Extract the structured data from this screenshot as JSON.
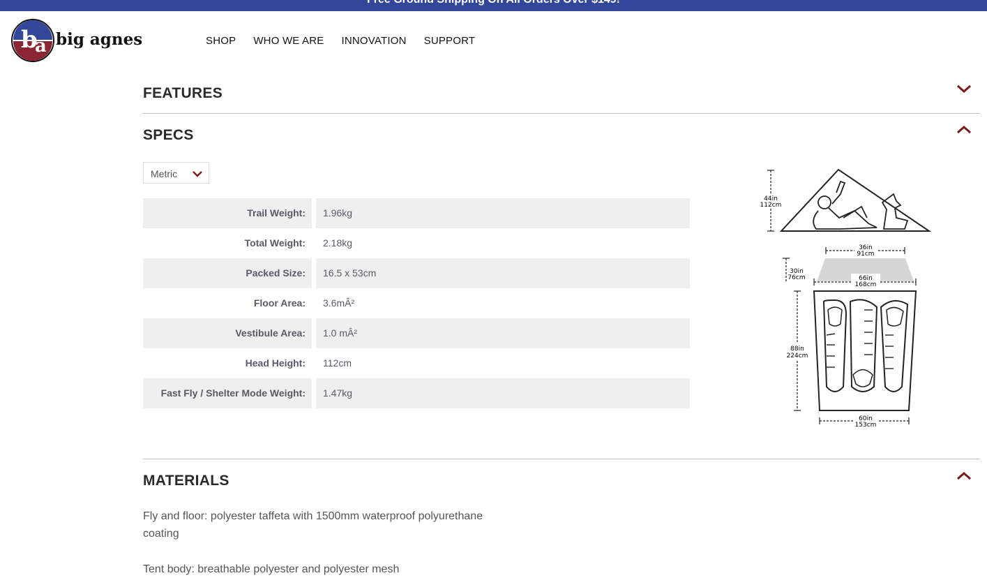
{
  "promo": {
    "text": "Free Ground Shipping On All Orders Over $149!"
  },
  "brand": {
    "name": "big agnes",
    "accent": "#7a1a1a",
    "blue": "#33479a"
  },
  "nav": {
    "items": [
      "SHOP",
      "WHO WE ARE",
      "INNOVATION",
      "SUPPORT"
    ]
  },
  "sections": {
    "features": {
      "title": "FEATURES",
      "state": "collapsed"
    },
    "specs": {
      "title": "SPECS",
      "state": "expanded"
    },
    "materials": {
      "title": "MATERIALS",
      "state": "expanded"
    }
  },
  "units": {
    "selected": "Metric"
  },
  "specs": [
    {
      "label": "Trail Weight:",
      "value": "1.96kg"
    },
    {
      "label": "Total Weight:",
      "value": "2.18kg"
    },
    {
      "label": "Packed Size:",
      "value": "16.5 x 53cm"
    },
    {
      "label": "Floor Area:",
      "value": "3.6mÂ²"
    },
    {
      "label": "Vestibule Area:",
      "value": "1.0 mÂ²"
    },
    {
      "label": "Head Height:",
      "value": "112cm"
    },
    {
      "label": "Fast Fly / Shelter Mode Weight:",
      "value": "1.47kg"
    }
  ],
  "diagram": {
    "height_in": "44in",
    "height_cm": "112cm",
    "top_in": "36in",
    "top_cm": "91cm",
    "vest_in": "30in",
    "vest_cm": "76cm",
    "width_in": "66in",
    "width_cm": "168cm",
    "length_in": "88in",
    "length_cm": "224cm",
    "bottom_in": "60in",
    "bottom_cm": "153cm"
  },
  "materials": {
    "line1a": "Fly and floor: polyester taffeta with 1500mm waterproof polyurethane",
    "line1b": "coating",
    "line2": "Tent body: breathable polyester and polyester mesh"
  }
}
